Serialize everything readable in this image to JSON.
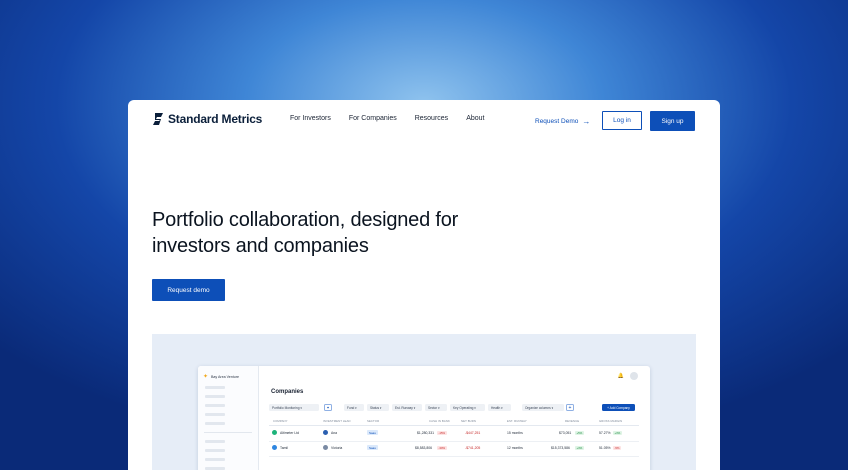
{
  "brand": {
    "name": "Standard Metrics"
  },
  "nav": {
    "items": [
      "For Investors",
      "For Companies",
      "Resources",
      "About"
    ],
    "request_demo": "Request Demo",
    "login": "Log in",
    "signup": "Sign up"
  },
  "hero": {
    "title_line1": "Portfolio collaboration, designed for",
    "title_line2": "investors and companies",
    "cta": "Request demo"
  },
  "preview": {
    "org_name": "Bay Area Venture",
    "page_title": "Companies",
    "filters": [
      "Portfolio Monitoring",
      "Fund",
      "Status",
      "Est. Runway",
      "Sector",
      "Key Operating",
      "Health",
      "Organize columns"
    ],
    "add_company": "+ Add Company",
    "columns": [
      "COMPANY",
      "INVESTMENT LEAD",
      "SECTOR",
      "CASH IN BANK",
      "NET BURN",
      "EST. RUNWAY",
      "REVENUE",
      "GROSS MARGIN"
    ],
    "rows": [
      {
        "company": "Altimeter Ltd",
        "lead": "Ana",
        "sector": "Saas",
        "cash": "$1,280,331",
        "cash_delta": "-15%",
        "burn": "-$447,251",
        "burn_delta": "",
        "runway": "15 months",
        "revenue": "$73,051",
        "revenue_delta": "+5%",
        "margin": "57.27%",
        "margin_delta": "+3%"
      },
      {
        "company": "Tamil",
        "lead": "Victoria",
        "sector": "Saas",
        "cash": "$8,583,806",
        "cash_delta": "-30%",
        "burn": "-$741,205",
        "burn_delta": "",
        "runway": "12 months",
        "revenue": "$15,373,586",
        "revenue_delta": "+3%",
        "margin": "51.05%",
        "margin_delta": "-5%"
      }
    ]
  }
}
